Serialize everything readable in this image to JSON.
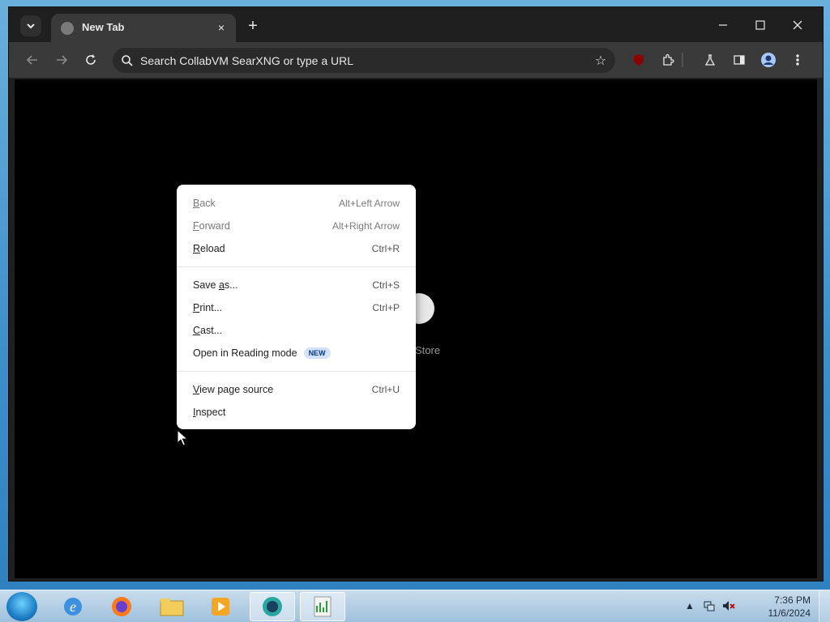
{
  "tab": {
    "title": "New Tab",
    "close": "×"
  },
  "new_tab": "+",
  "window_controls": {
    "minimize": "—",
    "maximize": "☐",
    "close": "✕"
  },
  "omnibox": {
    "placeholder": "Search CollabVM SearXNG or type a URL"
  },
  "background": {
    "shortcut_label": "Store"
  },
  "context_menu": {
    "groups": [
      [
        {
          "label_pre": "",
          "accel": "B",
          "label_post": "ack",
          "shortcut": "Alt+Left Arrow",
          "disabled": true
        },
        {
          "label_pre": "",
          "accel": "F",
          "label_post": "orward",
          "shortcut": "Alt+Right Arrow",
          "disabled": true
        },
        {
          "label_pre": "",
          "accel": "R",
          "label_post": "eload",
          "shortcut": "Ctrl+R",
          "disabled": false
        }
      ],
      [
        {
          "label_pre": "Save ",
          "accel": "a",
          "label_post": "s...",
          "shortcut": "Ctrl+S",
          "disabled": false
        },
        {
          "label_pre": "",
          "accel": "P",
          "label_post": "rint...",
          "shortcut": "Ctrl+P",
          "disabled": false
        },
        {
          "label_pre": "",
          "accel": "C",
          "label_post": "ast...",
          "shortcut": "",
          "disabled": false
        },
        {
          "label_pre": "Open in Reading mode",
          "accel": "",
          "label_post": "",
          "shortcut": "",
          "disabled": false,
          "badge": "NEW"
        }
      ],
      [
        {
          "label_pre": "",
          "accel": "V",
          "label_post": "iew page source",
          "shortcut": "Ctrl+U",
          "disabled": false
        },
        {
          "label_pre": "",
          "accel": "I",
          "label_post": "nspect",
          "shortcut": "",
          "disabled": false
        }
      ]
    ]
  },
  "taskbar": {
    "apps": [
      "internet-explorer",
      "firefox",
      "file-explorer",
      "media-player",
      "collabvm",
      "notepad-chart"
    ],
    "clock": {
      "time": "7:36 PM",
      "date": "11/6/2024"
    }
  }
}
